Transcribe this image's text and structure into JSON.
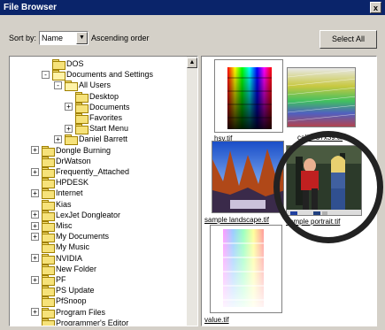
{
  "window": {
    "title": "File Browser",
    "close_label": "x"
  },
  "sort": {
    "label": "Sort by:",
    "value": "Name",
    "order_label": "Ascending order"
  },
  "buttons": {
    "select_all": "Select All"
  },
  "tree": [
    {
      "label": "DOS",
      "expander": "",
      "open": false
    },
    {
      "label": "Documents and Settings",
      "expander": "-",
      "open": true
    },
    {
      "label": "All Users",
      "expander": "-",
      "open": true
    },
    {
      "label": "Desktop",
      "expander": "",
      "open": false
    },
    {
      "label": "Documents",
      "expander": "+",
      "open": false
    },
    {
      "label": "Favorites",
      "expander": "",
      "open": false
    },
    {
      "label": "Start Menu",
      "expander": "+",
      "open": false
    },
    {
      "label": "Daniel Barrett",
      "expander": "+",
      "open": false
    },
    {
      "label": "Dongle Burning",
      "expander": "+",
      "open": false
    },
    {
      "label": "DrWatson",
      "expander": "",
      "open": false
    },
    {
      "label": "Frequently_Attached",
      "expander": "+",
      "open": false
    },
    {
      "label": "HPDESK",
      "expander": "",
      "open": false
    },
    {
      "label": "Internet",
      "expander": "+",
      "open": false
    },
    {
      "label": "Kias",
      "expander": "",
      "open": false
    },
    {
      "label": "LexJet Dongleator",
      "expander": "+",
      "open": false
    },
    {
      "label": "Misc",
      "expander": "+",
      "open": false
    },
    {
      "label": "My Documents",
      "expander": "+",
      "open": false
    },
    {
      "label": "My Music",
      "expander": "",
      "open": false
    },
    {
      "label": "NVIDIA",
      "expander": "+",
      "open": false
    },
    {
      "label": "New Folder",
      "expander": "",
      "open": false
    },
    {
      "label": "PF",
      "expander": "+",
      "open": false
    },
    {
      "label": "PS Update",
      "expander": "",
      "open": false
    },
    {
      "label": "PfSnoop",
      "expander": "",
      "open": false
    },
    {
      "label": "Program Files",
      "expander": "+",
      "open": false
    },
    {
      "label": "Programmer's Editor",
      "expander": "",
      "open": false
    }
  ],
  "thumbnails": [
    {
      "label": "hsv.tif"
    },
    {
      "label": "calib_57x39.tif"
    },
    {
      "label": "sample landscape.tif"
    },
    {
      "label": "sample portrait.tif"
    },
    {
      "label": "value.tif"
    }
  ]
}
